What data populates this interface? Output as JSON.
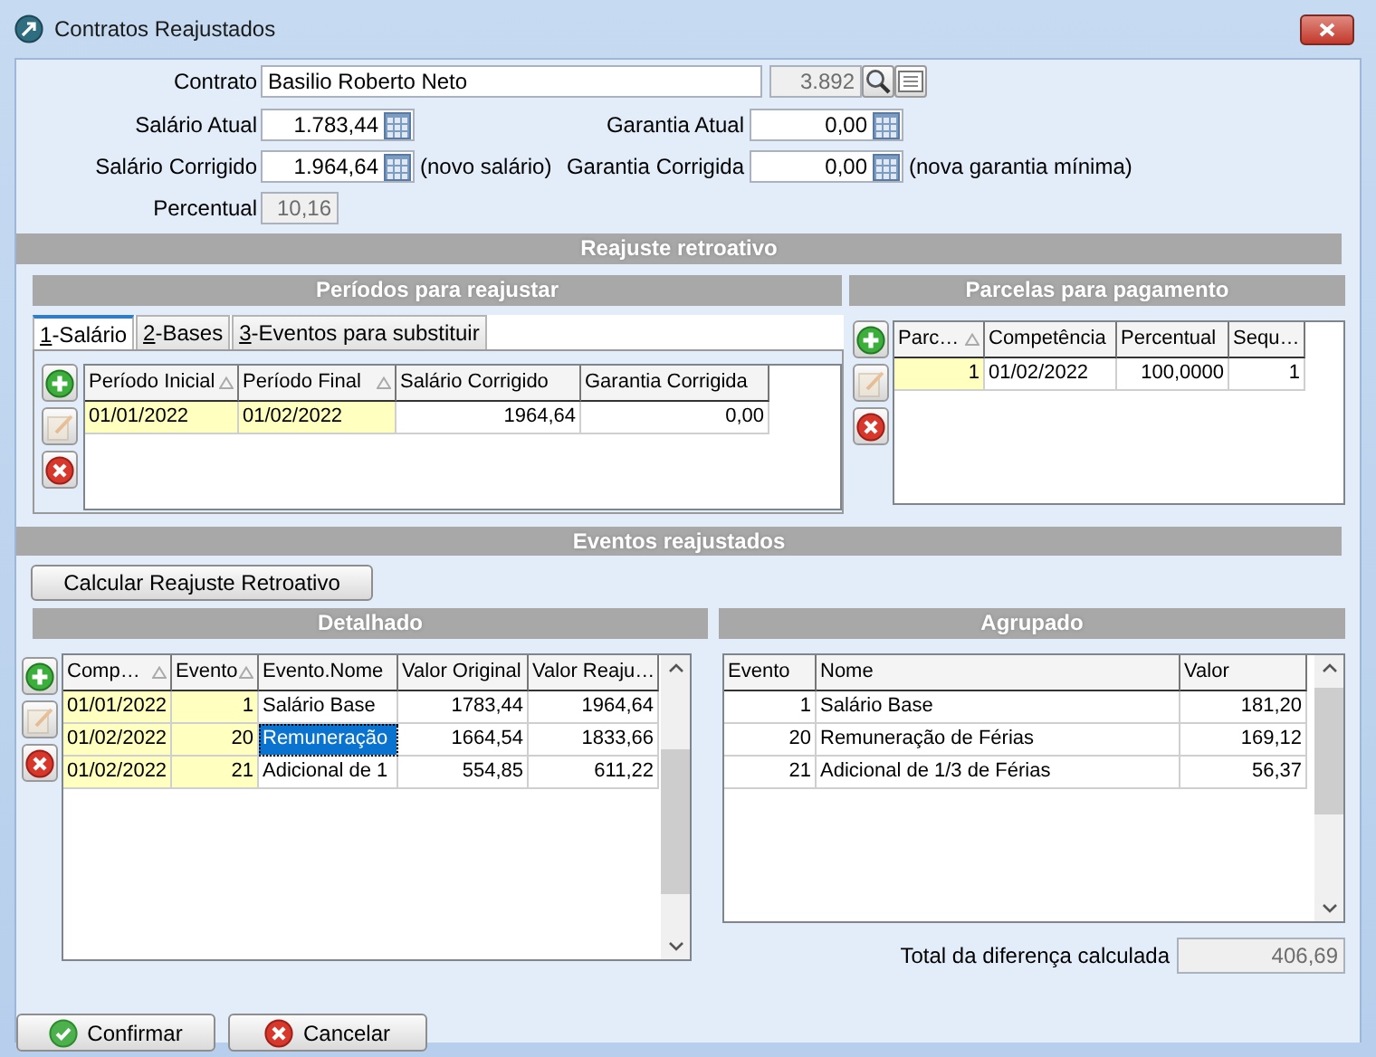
{
  "window": {
    "title": "Contratos Reajustados"
  },
  "contract": {
    "label": "Contrato",
    "name": "Basilio Roberto Neto",
    "code": "3.892"
  },
  "fields": [
    {
      "label": "Salário Atual",
      "value": "1.783,44"
    },
    {
      "label": "Garantia Atual",
      "value": "0,00"
    },
    {
      "label": "Salário Corrigido",
      "value": "1.964,64",
      "note": "(novo salário)"
    },
    {
      "label": "Garantia Corrigida",
      "value": "0,00",
      "note": "(nova garantia mínima)"
    }
  ],
  "percentual": {
    "label": "Percentual",
    "value": "10,16"
  },
  "retro": {
    "title": "Reajuste retroativo",
    "periods": {
      "title": "Períodos para reajustar",
      "tabs": [
        {
          "hotkey": "1",
          "label": "-Salário",
          "selected": true
        },
        {
          "hotkey": "2",
          "label": "-Bases",
          "selected": false
        },
        {
          "hotkey": "3",
          "label": "-Eventos para substituir",
          "selected": false
        }
      ],
      "toolbar": [
        {
          "kind": "add",
          "disabled": false
        },
        {
          "kind": "edit",
          "disabled": true
        },
        {
          "kind": "delete",
          "disabled": false
        }
      ],
      "grid": {
        "columns": [
          {
            "title": "Período Inicial",
            "kind": "date",
            "key": true,
            "sorted": true
          },
          {
            "title": "Período Final",
            "kind": "date",
            "key": true,
            "sorted": true
          },
          {
            "title": "Salário Corrigido",
            "kind": "number",
            "key": false,
            "sorted": false
          },
          {
            "title": "Garantia Corrigida",
            "kind": "number",
            "key": false,
            "sorted": false
          }
        ],
        "rows": [
          {
            "cells": [
              "01/01/2022",
              "01/02/2022",
              "1964,64",
              "0,00"
            ]
          }
        ]
      }
    },
    "installments": {
      "title": "Parcelas para pagamento",
      "toolbar": [
        {
          "kind": "add",
          "disabled": false
        },
        {
          "kind": "edit",
          "disabled": true
        },
        {
          "kind": "delete",
          "disabled": false
        }
      ],
      "grid": {
        "columns": [
          {
            "title": "Parc…",
            "kind": "number",
            "key": true,
            "sorted": true
          },
          {
            "title": "Competência",
            "kind": "date",
            "key": false,
            "sorted": false
          },
          {
            "title": "Percentual",
            "kind": "number",
            "key": false,
            "sorted": false
          },
          {
            "title": "Sequ…",
            "kind": "number",
            "key": false,
            "sorted": false
          }
        ],
        "rows": [
          {
            "cells": [
              "1",
              "01/02/2022",
              "100,0000",
              "1"
            ]
          }
        ]
      }
    }
  },
  "events": {
    "title": "Eventos reajustados",
    "calculate_button": "Calcular Reajuste Retroativo",
    "detailed": {
      "title": "Detalhado",
      "toolbar": [
        {
          "kind": "add",
          "disabled": false
        },
        {
          "kind": "edit",
          "disabled": true
        },
        {
          "kind": "delete",
          "disabled": false
        }
      ],
      "grid": {
        "columns": [
          {
            "title": "Comp…",
            "kind": "date",
            "key": true,
            "sorted": true
          },
          {
            "title": "Evento",
            "kind": "number",
            "key": true,
            "sorted": true
          },
          {
            "title": "Evento.Nome",
            "kind": "text",
            "key": false,
            "sorted": false
          },
          {
            "title": "Valor Original",
            "kind": "number",
            "key": false,
            "sorted": false
          },
          {
            "title": "Valor Reaju…",
            "kind": "number",
            "key": false,
            "sorted": false
          }
        ],
        "rows": [
          {
            "cells": [
              {
                "text": "01/01/2022",
                "selected": false
              },
              {
                "text": "1",
                "selected": false
              },
              {
                "text": "Salário Base",
                "selected": false
              },
              {
                "text": "1783,44",
                "selected": false
              },
              {
                "text": "1964,64",
                "selected": false
              }
            ]
          },
          {
            "cells": [
              {
                "text": "01/02/2022",
                "selected": false
              },
              {
                "text": "20",
                "selected": false
              },
              {
                "text": "Remuneração",
                "selected": true
              },
              {
                "text": "1664,54",
                "selected": false
              },
              {
                "text": "1833,66",
                "selected": false
              }
            ]
          },
          {
            "cells": [
              {
                "text": "01/02/2022",
                "selected": false
              },
              {
                "text": "21",
                "selected": false
              },
              {
                "text": "Adicional de 1",
                "selected": false
              },
              {
                "text": "554,85",
                "selected": false
              },
              {
                "text": "611,22",
                "selected": false
              }
            ]
          }
        ]
      }
    },
    "grouped": {
      "title": "Agrupado",
      "grid": {
        "columns": [
          {
            "title": "Evento",
            "kind": "number",
            "key": false,
            "sorted": false
          },
          {
            "title": "Nome",
            "kind": "text",
            "key": false,
            "sorted": false
          },
          {
            "title": "Valor",
            "kind": "number",
            "key": false,
            "sorted": false
          }
        ],
        "rows": [
          {
            "cells": [
              "1",
              "Salário Base",
              "181,20"
            ]
          },
          {
            "cells": [
              "20",
              "Remuneração de Férias",
              "169,12"
            ]
          },
          {
            "cells": [
              "21",
              "Adicional de 1/3 de Férias",
              "56,37"
            ]
          }
        ]
      },
      "total": {
        "label": "Total da diferença calculada",
        "value": "406,69"
      }
    }
  },
  "buttons": [
    {
      "kind": "confirm",
      "label": "Confirmar"
    },
    {
      "kind": "cancel",
      "label": "Cancelar"
    }
  ]
}
